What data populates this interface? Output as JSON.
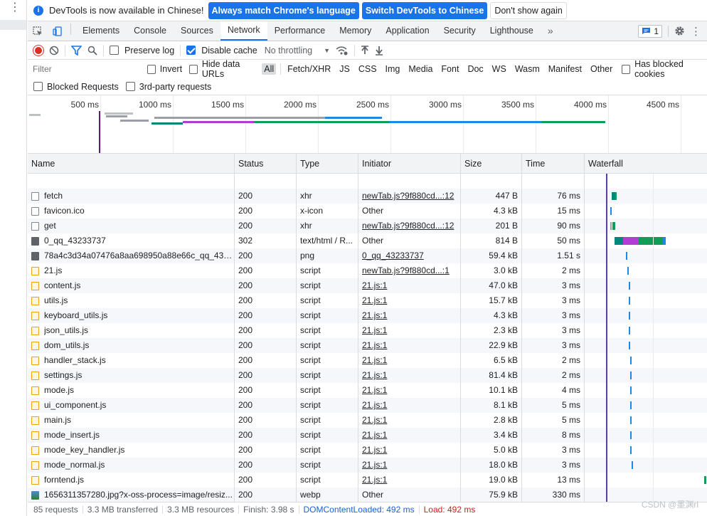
{
  "infobar": {
    "message": "DevTools is now available in Chinese!",
    "btn_match": "Always match Chrome's language",
    "btn_switch": "Switch DevTools to Chinese",
    "btn_dismiss": "Don't show again"
  },
  "tabs": [
    "Elements",
    "Console",
    "Sources",
    "Network",
    "Performance",
    "Memory",
    "Application",
    "Security",
    "Lighthouse"
  ],
  "active_tab": "Network",
  "issues_count": "1",
  "toolbar": {
    "preserve_log": "Preserve log",
    "disable_cache": "Disable cache",
    "throttling": "No throttling"
  },
  "filter": {
    "placeholder": "Filter",
    "invert": "Invert",
    "hide_data_urls": "Hide data URLs",
    "types": [
      "All",
      "Fetch/XHR",
      "JS",
      "CSS",
      "Img",
      "Media",
      "Font",
      "Doc",
      "WS",
      "Wasm",
      "Manifest",
      "Other"
    ],
    "has_blocked_cookies": "Has blocked cookies",
    "blocked_requests": "Blocked Requests",
    "third_party": "3rd-party requests"
  },
  "overview_ticks": [
    "500 ms",
    "1000 ms",
    "1500 ms",
    "2000 ms",
    "2500 ms",
    "3000 ms",
    "3500 ms",
    "4000 ms",
    "4500 ms"
  ],
  "columns": {
    "name": "Name",
    "status": "Status",
    "type": "Type",
    "initiator": "Initiator",
    "size": "Size",
    "time": "Time",
    "waterfall": "Waterfall"
  },
  "rows": [
    {
      "name": "fetch",
      "icon": "doc",
      "status": "200",
      "type": "xhr",
      "initiator": "newTab.js?9f880cd...:12",
      "init_link": true,
      "size": "447 B",
      "time": "76 ms"
    },
    {
      "name": "favicon.ico",
      "icon": "doc",
      "status": "200",
      "type": "x-icon",
      "initiator": "Other",
      "init_link": false,
      "size": "4.3 kB",
      "time": "15 ms"
    },
    {
      "name": "get",
      "icon": "doc",
      "status": "200",
      "type": "xhr",
      "initiator": "newTab.js?9f880cd...:12",
      "init_link": true,
      "size": "201 B",
      "time": "90 ms"
    },
    {
      "name": "0_qq_43233737",
      "icon": "img",
      "status": "302",
      "type": "text/html / R...",
      "initiator": "Other",
      "init_link": false,
      "size": "814 B",
      "time": "50 ms"
    },
    {
      "name": "78a4c3d34a07476a8aa698950a88e66c_qq_432...",
      "icon": "img",
      "status": "200",
      "type": "png",
      "initiator": "0_qq_43233737",
      "init_link": true,
      "size": "59.4 kB",
      "time": "1.51 s"
    },
    {
      "name": "21.js",
      "icon": "js",
      "status": "200",
      "type": "script",
      "initiator": "newTab.js?9f880cd...:1",
      "init_link": true,
      "size": "3.0 kB",
      "time": "2 ms"
    },
    {
      "name": "content.js",
      "icon": "js",
      "status": "200",
      "type": "script",
      "initiator": "21.js:1",
      "init_link": true,
      "size": "47.0 kB",
      "time": "3 ms"
    },
    {
      "name": "utils.js",
      "icon": "js",
      "status": "200",
      "type": "script",
      "initiator": "21.js:1",
      "init_link": true,
      "size": "15.7 kB",
      "time": "3 ms"
    },
    {
      "name": "keyboard_utils.js",
      "icon": "js",
      "status": "200",
      "type": "script",
      "initiator": "21.js:1",
      "init_link": true,
      "size": "4.3 kB",
      "time": "3 ms"
    },
    {
      "name": "json_utils.js",
      "icon": "js",
      "status": "200",
      "type": "script",
      "initiator": "21.js:1",
      "init_link": true,
      "size": "2.3 kB",
      "time": "3 ms"
    },
    {
      "name": "dom_utils.js",
      "icon": "js",
      "status": "200",
      "type": "script",
      "initiator": "21.js:1",
      "init_link": true,
      "size": "22.9 kB",
      "time": "3 ms"
    },
    {
      "name": "handler_stack.js",
      "icon": "js",
      "status": "200",
      "type": "script",
      "initiator": "21.js:1",
      "init_link": true,
      "size": "6.5 kB",
      "time": "2 ms"
    },
    {
      "name": "settings.js",
      "icon": "js",
      "status": "200",
      "type": "script",
      "initiator": "21.js:1",
      "init_link": true,
      "size": "81.4 kB",
      "time": "2 ms"
    },
    {
      "name": "mode.js",
      "icon": "js",
      "status": "200",
      "type": "script",
      "initiator": "21.js:1",
      "init_link": true,
      "size": "10.1 kB",
      "time": "4 ms"
    },
    {
      "name": "ui_component.js",
      "icon": "js",
      "status": "200",
      "type": "script",
      "initiator": "21.js:1",
      "init_link": true,
      "size": "8.1 kB",
      "time": "5 ms"
    },
    {
      "name": "main.js",
      "icon": "js",
      "status": "200",
      "type": "script",
      "initiator": "21.js:1",
      "init_link": true,
      "size": "2.8 kB",
      "time": "5 ms"
    },
    {
      "name": "mode_insert.js",
      "icon": "js",
      "status": "200",
      "type": "script",
      "initiator": "21.js:1",
      "init_link": true,
      "size": "3.4 kB",
      "time": "8 ms"
    },
    {
      "name": "mode_key_handler.js",
      "icon": "js",
      "status": "200",
      "type": "script",
      "initiator": "21.js:1",
      "init_link": true,
      "size": "5.0 kB",
      "time": "3 ms"
    },
    {
      "name": "mode_normal.js",
      "icon": "js",
      "status": "200",
      "type": "script",
      "initiator": "21.js:1",
      "init_link": true,
      "size": "18.0 kB",
      "time": "3 ms"
    },
    {
      "name": "forntend.js",
      "icon": "js",
      "status": "200",
      "type": "script",
      "initiator": "21.js:1",
      "init_link": true,
      "size": "19.0 kB",
      "time": "13 ms"
    },
    {
      "name": "1656311357280.jpg?x-oss-process=image/resiz...",
      "icon": "webp",
      "status": "200",
      "type": "webp",
      "initiator": "Other",
      "init_link": false,
      "size": "75.9 kB",
      "time": "330 ms"
    }
  ],
  "statusbar": {
    "requests": "85 requests",
    "transferred": "3.3 MB transferred",
    "resources": "3.3 MB resources",
    "finish": "Finish: 3.98 s",
    "dcl": "DOMContentLoaded: 492 ms",
    "load": "Load: 492 ms"
  },
  "watermark": "CSDN @墨渊rl",
  "colors": {
    "accent": "#1a73e8",
    "record": "#d93025",
    "wf_green": "#0f9d58",
    "wf_purple": "#b13cd6",
    "wf_blue": "#1e88e5",
    "wf_teal": "#00897b"
  }
}
